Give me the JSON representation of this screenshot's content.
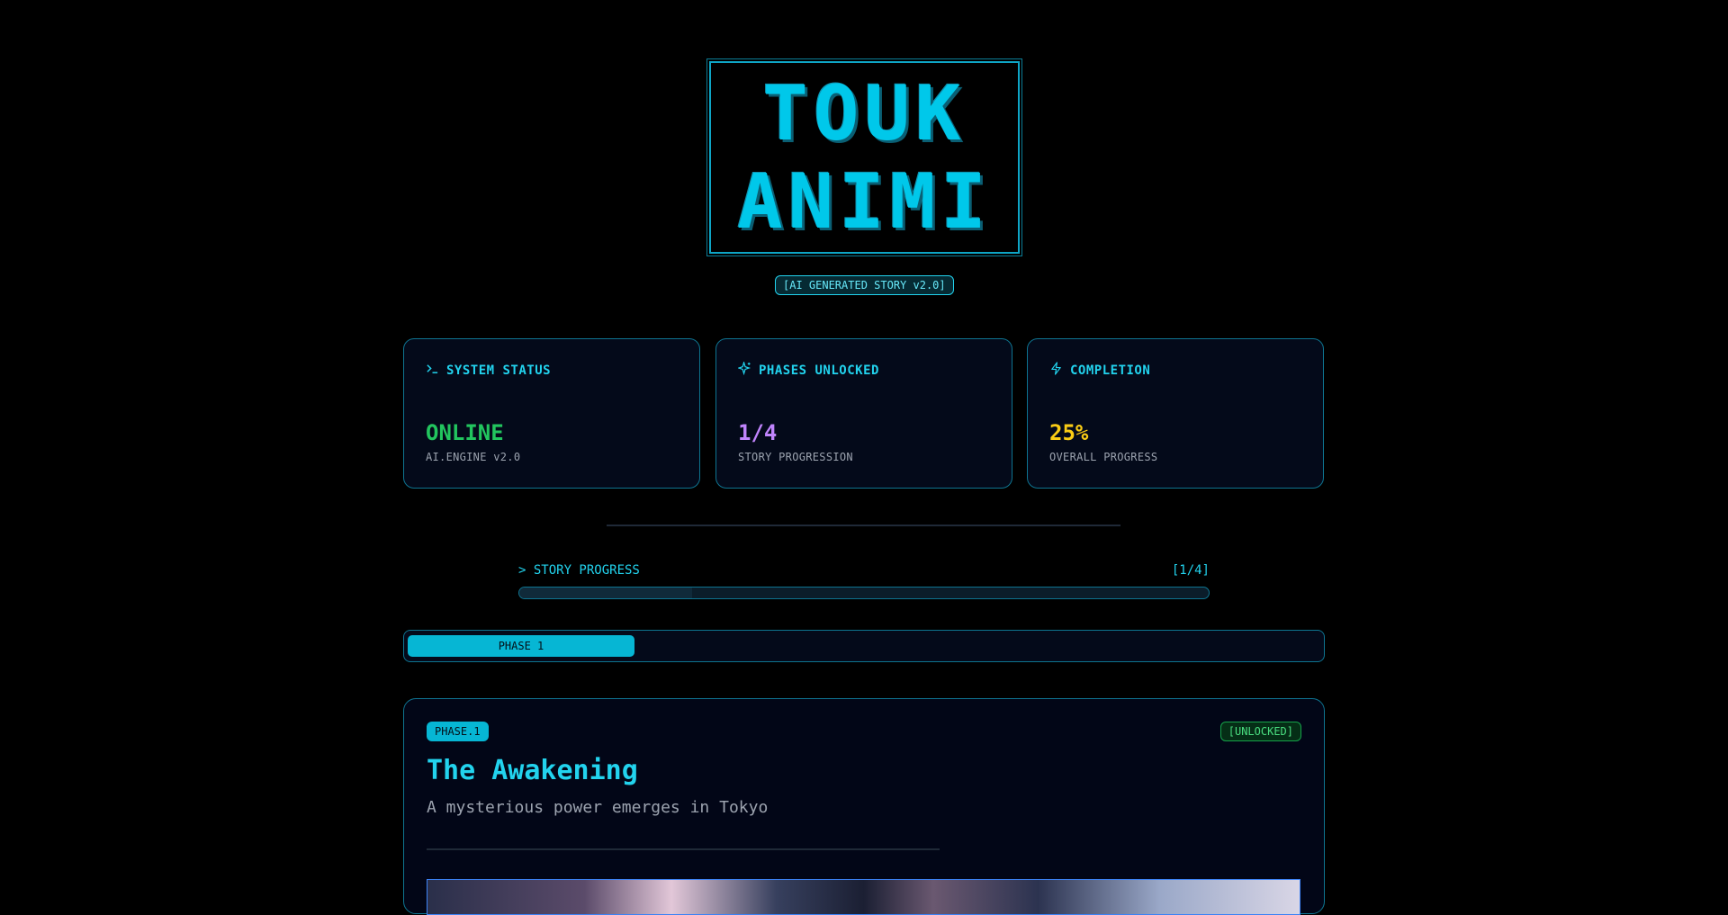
{
  "logo": {
    "line1": "TOUK",
    "line2": "ANIMI"
  },
  "version_badge": "[AI GENERATED STORY v2.0]",
  "stats": [
    {
      "icon": "terminal-icon",
      "title": "SYSTEM STATUS",
      "value": "ONLINE",
      "sub": "AI.ENGINE v2.0",
      "color": "#22c55e"
    },
    {
      "icon": "sparkles-icon",
      "title": "PHASES UNLOCKED",
      "value": "1/4",
      "sub": "STORY PROGRESSION",
      "color": "#c084fc"
    },
    {
      "icon": "zap-icon",
      "title": "COMPLETION",
      "value": "25%",
      "sub": "OVERALL PROGRESS",
      "color": "#facc15"
    }
  ],
  "story_progress": {
    "label": "> STORY PROGRESS",
    "count": "[1/4]"
  },
  "tabs": [
    {
      "label": "PHASE 1"
    }
  ],
  "phase": {
    "badge": "PHASE.1",
    "status": "[UNLOCKED]",
    "title": "The Awakening",
    "subtitle": "A mysterious power emerges in Tokyo"
  },
  "colors": {
    "accent": "#22d3ee",
    "border": "#0e7490",
    "background": "#000000"
  }
}
